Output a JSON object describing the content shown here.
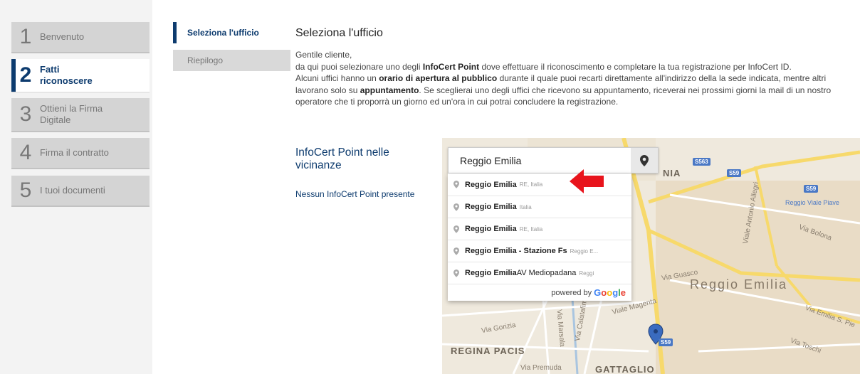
{
  "steps": [
    {
      "num": "1",
      "label": "Benvenuto"
    },
    {
      "num": "2",
      "label": "Fatti riconoscere"
    },
    {
      "num": "3",
      "label": "Ottieni la Firma Digitale"
    },
    {
      "num": "4",
      "label": "Firma il contratto"
    },
    {
      "num": "5",
      "label": "I tuoi documenti"
    }
  ],
  "subtabs": {
    "active": "Seleziona l'ufficio",
    "other": "Riepilogo"
  },
  "main": {
    "title": "Seleziona l'ufficio",
    "greeting": "Gentile cliente,",
    "p1_a": "da qui puoi selezionare uno degli ",
    "p1_b": "InfoCert Point",
    "p1_c": " dove effettuare il riconoscimento e completare la tua registrazione per InfoCert ID.",
    "p2_a": "Alcuni uffici hanno un ",
    "p2_b": "orario di apertura al pubblico",
    "p2_c": " durante il quale puoi recarti direttamente all'indirizzo della la sede indicata, mentre altri lavorano solo su ",
    "p2_d": "appuntamento",
    "p2_e": ". Se sceglierai uno degli uffici che ricevono su appuntamento, riceverai nei prossimi giorni la mail di un nostro operatore che ti proporrà un giorno ed un'ora in cui potrai concludere la registrazione."
  },
  "nearby": {
    "title": "InfoCert Point nelle vicinanze",
    "empty": "Nessun InfoCert Point presente"
  },
  "search": {
    "value": "Reggio Emilia"
  },
  "suggestions": [
    {
      "main": "Reggio Emilia",
      "secondary": "RE, Italia"
    },
    {
      "main": "Reggio Emilia",
      "secondary": "Italia"
    },
    {
      "main": "Reggio Emilia",
      "secondary": "RE, Italia"
    },
    {
      "main": "Reggio Emilia - Stazione Fs",
      "secondary": "Reggio E..."
    },
    {
      "main": "Reggio Emilia",
      "main_rest": " AV Mediopadana",
      "secondary": "Reggi"
    }
  ],
  "powered_by": {
    "text": "powered by",
    "brand": "Google"
  },
  "map_labels": {
    "city": "Reggio Emilia",
    "regina": "REGINA PACIS",
    "gattaglio": "GATTAGLIO",
    "nia": "NIA",
    "via_guasco": "Via Guasco",
    "via_gorizia": "Via Gorizia",
    "via_premuda": "Via Premuda",
    "via_bolona": "Via Bolona",
    "via_toschi": "Via Toschi",
    "via_emilia": "Via Emilia S. Pie",
    "viale_magenta": "Viale Magenta",
    "viale_allegri": "Viale Antonio Allegri",
    "reggio_viale_piave": "Reggio Viale Piave",
    "via_calatafimi": "Via Calatafimi",
    "via_marsala": "Via Marsala",
    "s563": "S563",
    "s59a": "S59",
    "s59b": "S59",
    "s59c": "S59"
  },
  "colors": {
    "brand": "#0d3b6e",
    "arrow": "#e8141c",
    "map_bg": "#efe9dd",
    "road": "#f7d96b"
  }
}
